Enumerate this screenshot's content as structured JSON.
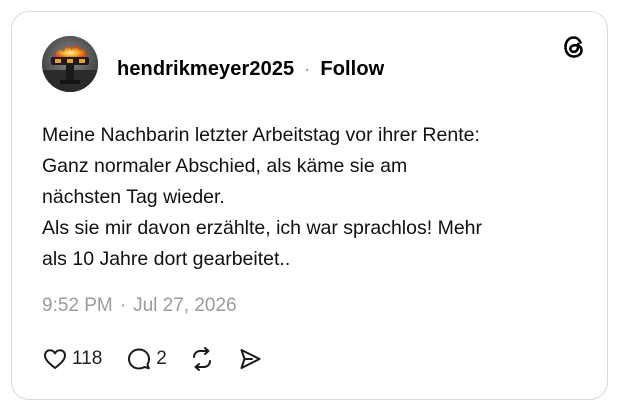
{
  "post": {
    "username": "hendrikmeyer2025",
    "separator": "·",
    "follow_label": "Follow",
    "text_lines": [
      "Meine Nachbarin letzter Arbeitstag vor ihrer Rente:",
      "Ganz normaler Abschied, als käme sie am",
      "nächsten Tag wieder.",
      "Als sie mir davon erzählte, ich war sprachlos! Mehr",
      "als 10 Jahre dort gearbeitet.."
    ],
    "time": "9:52 PM",
    "date_separator": "·",
    "date": "Jul 27, 2026",
    "likes": "118",
    "replies": "2"
  },
  "icons": {
    "brand": "threads-logo-icon",
    "like": "heart-icon",
    "reply": "speech-bubble-icon",
    "repost": "repost-icon",
    "share": "send-icon"
  },
  "colors": {
    "text": "#111111",
    "muted": "#9b9b9b",
    "border": "#d9d9d9"
  }
}
